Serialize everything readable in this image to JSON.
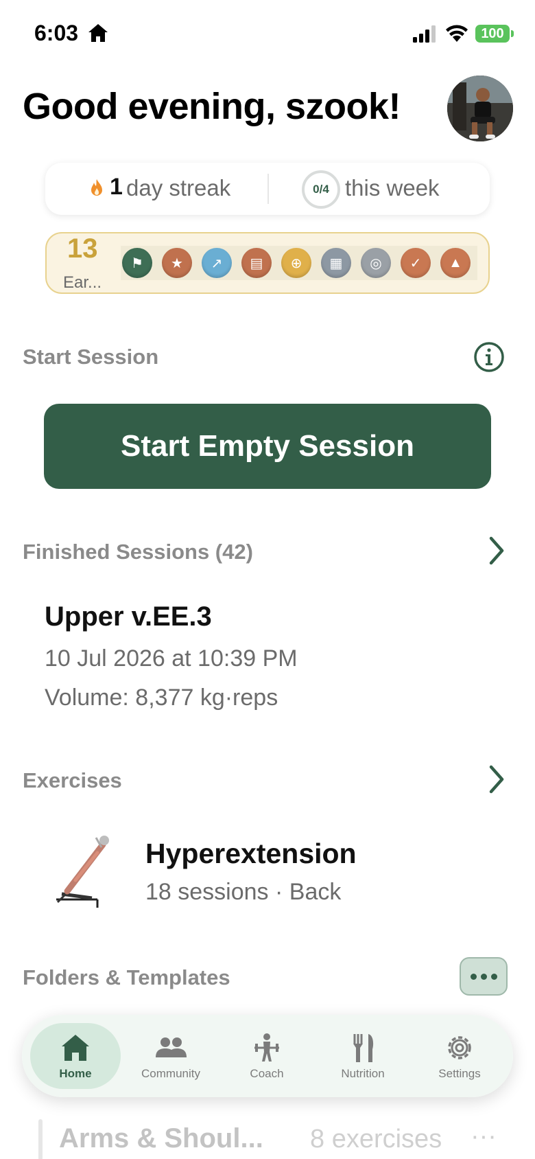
{
  "status_bar": {
    "time": "6:03",
    "battery": "100"
  },
  "header": {
    "greeting": "Good evening, szook!"
  },
  "streak": {
    "count": "1",
    "label": "day streak",
    "week_progress": "0/4",
    "week_label": "this week"
  },
  "badges": {
    "count": "13",
    "caption": "Ear...",
    "items": [
      {
        "icon": "lifter-badge-icon",
        "color": "#3e6e55"
      },
      {
        "icon": "star-badge-icon",
        "color": "#c0714e"
      },
      {
        "icon": "arrow-badge-icon",
        "color": "#6aaed3"
      },
      {
        "icon": "map-badge-icon",
        "color": "#c0714e"
      },
      {
        "icon": "target-badge-icon",
        "color": "#e0b04a"
      },
      {
        "icon": "calendar-badge-icon",
        "color": "#8d98a3"
      },
      {
        "icon": "bullseye-badge-icon",
        "color": "#9aa0a6"
      },
      {
        "icon": "check-badge-icon",
        "color": "#c97852"
      },
      {
        "icon": "weight-badge-icon",
        "color": "#c97852"
      }
    ]
  },
  "start_session": {
    "title": "Start Session",
    "button_label": "Start Empty Session"
  },
  "finished_sessions": {
    "title": "Finished Sessions (42)",
    "latest": {
      "name": "Upper v.EE.3",
      "date": "10 Jul 2026 at 10:39 PM",
      "volume": "Volume: 8,377 kg·reps"
    }
  },
  "exercises": {
    "title": "Exercises",
    "latest": {
      "name": "Hyperextension",
      "meta": "18 sessions · Back"
    }
  },
  "folders": {
    "title": "Folders & Templates",
    "first_template": {
      "name": "Arms & Shoul...",
      "count": "8 exercises",
      "more": "···"
    }
  },
  "tab_bar": {
    "tabs": [
      {
        "label": "Home",
        "icon": "home-icon"
      },
      {
        "label": "Community",
        "icon": "community-icon"
      },
      {
        "label": "Coach",
        "icon": "coach-icon"
      },
      {
        "label": "Nutrition",
        "icon": "nutrition-icon"
      },
      {
        "label": "Settings",
        "icon": "settings-icon"
      }
    ]
  },
  "colors": {
    "accent": "#335e48",
    "badge_gold": "#c9a23b",
    "muted_text": "#8a8a8a"
  }
}
